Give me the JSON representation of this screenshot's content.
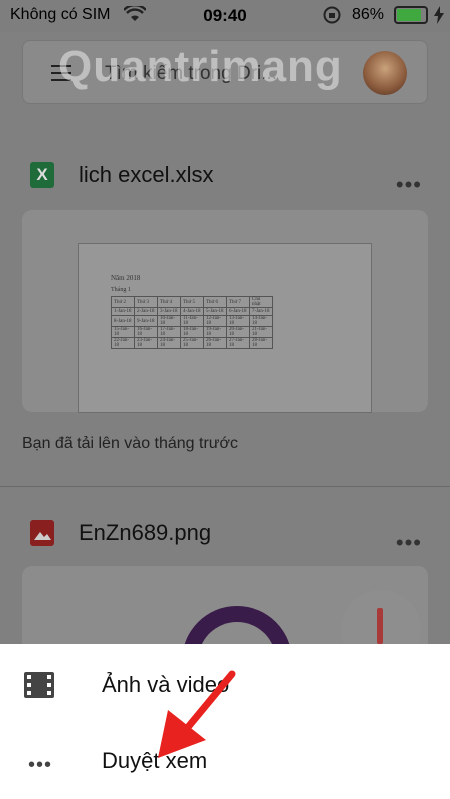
{
  "status_bar": {
    "carrier": "Không có SIM",
    "time": "09:40",
    "battery_percent": "86%",
    "battery_level": 0.86,
    "icons": [
      "wifi-icon",
      "rotation-lock-icon",
      "battery-icon",
      "charging-bolt-icon"
    ]
  },
  "search": {
    "placeholder": "Tìm kiếm trong Dri..."
  },
  "watermark": "Quantrimang",
  "files": [
    {
      "name": "lich excel.xlsx",
      "icon": "excel-file-icon",
      "icon_letter": "X",
      "preview": {
        "line1": "Năm                    2018",
        "line2": "Tháng 1",
        "header": [
          "Thứ 2",
          "Thứ 3",
          "Thứ 4",
          "Thứ 5",
          "Thứ 6",
          "Thứ 7",
          "Chủ nhật"
        ],
        "rows": [
          [
            "1-Jan-18",
            "2-Jan-18",
            "3-Jan-18",
            "4-Jan-18",
            "5-Jan-18",
            "6-Jan-18",
            "7-Jan-18"
          ],
          [
            "8-Jan-18",
            "9-Jan-18",
            "10-Jan-18",
            "11-Jan-18",
            "12-Jan-18",
            "13-Jan-18",
            "14-Jan-18"
          ],
          [
            "15-Jan-18",
            "16-Jan-18",
            "17-Jan-18",
            "18-Jan-18",
            "19-Jan-18",
            "20-Jan-18",
            "21-Jan-18"
          ],
          [
            "22-Jan-18",
            "23-Jan-18",
            "24-Jan-18",
            "25-Jan-18",
            "26-Jan-18",
            "27-Jan-18",
            "28-Jan-18"
          ]
        ]
      },
      "note": "Bạn đã tải lên vào tháng trước"
    },
    {
      "name": "EnZn689.png",
      "icon": "image-file-icon"
    }
  ],
  "fab": {
    "icon": "plus-icon"
  },
  "bottom_sheet": {
    "items": [
      {
        "label": "Ảnh và video",
        "icon": "film-icon"
      },
      {
        "label": "Duyệt xem",
        "icon": "more-horizontal-icon"
      }
    ]
  },
  "annotation": {
    "color": "#e8231f"
  }
}
